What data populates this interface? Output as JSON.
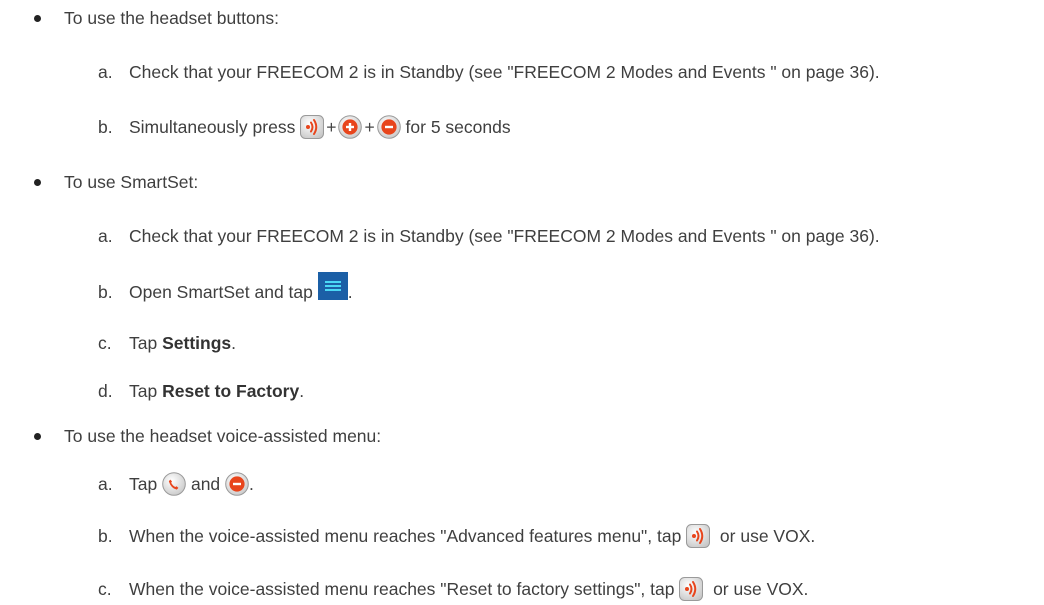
{
  "colors": {
    "text": "#3f3f3f",
    "orange": "#e8451c",
    "menu_bg": "#1b5fa6",
    "menu_lines": "#4ad8f5"
  },
  "sections": [
    {
      "bullet": "To use the headset buttons:",
      "steps": [
        {
          "letter": "a.",
          "text": "Check that your FREECOM 2 is in Standby (see \"FREECOM 2 Modes and Events \" on page 36)."
        },
        {
          "letter": "b.",
          "before": "Simultaneously press",
          "plus": "+",
          "after": "for 5 seconds",
          "icons": [
            "voice-button-icon",
            "plus-button-icon",
            "minus-button-icon"
          ]
        }
      ]
    },
    {
      "bullet": "To use SmartSet:",
      "steps": [
        {
          "letter": "a.",
          "text": "Check that your FREECOM 2 is in Standby (see \"FREECOM 2 Modes and Events \" on page 36)."
        },
        {
          "letter": "b.",
          "before": "Open SmartSet and tap",
          "after": ".",
          "icon": "hamburger-menu-icon"
        },
        {
          "letter": "c.",
          "before": "Tap",
          "bold": "Settings",
          "after": "."
        },
        {
          "letter": "d.",
          "before": "Tap",
          "bold": "Reset to Factory",
          "after": "."
        }
      ]
    },
    {
      "bullet": "To use the headset voice-assisted menu:",
      "steps": [
        {
          "letter": "a.",
          "before": "Tap",
          "middle": "and",
          "after": ".",
          "icons": [
            "phone-button-icon",
            "minus-button-icon"
          ]
        },
        {
          "letter": "b.",
          "before": "When the voice-assisted menu reaches \"Advanced features menu\", tap",
          "after": "or use VOX.",
          "icon": "voice-button-icon"
        },
        {
          "letter": "c.",
          "before": "When the voice-assisted menu reaches \"Reset to factory settings\", tap",
          "after": "or use VOX.",
          "icon": "voice-button-icon"
        }
      ]
    }
  ]
}
